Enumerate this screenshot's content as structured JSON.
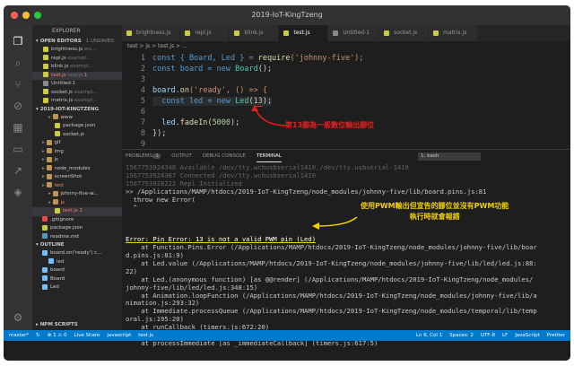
{
  "window": {
    "title": "2019-IoT-KingTzeng"
  },
  "sidebar": {
    "title": "EXPLORER",
    "open_editors_label": "OPEN EDITORS",
    "open_editors_badge": "1 UNSAVED",
    "open_editors": [
      {
        "label": "brightness.js",
        "suffix": "wo...",
        "color": "#cbcb41"
      },
      {
        "label": "repl.js",
        "suffix": "exampl...",
        "color": "#cbcb41"
      },
      {
        "label": "blink.js",
        "suffix": "exampl...",
        "color": "#cbcb41"
      },
      {
        "label": "test.js",
        "suffix": "test/js",
        "badge": "1",
        "color": "#cbcb41"
      },
      {
        "label": "Untitled-1",
        "suffix": "",
        "color": "#8a8a8a"
      },
      {
        "label": "socket.js",
        "suffix": "exampl...",
        "color": "#cbcb41"
      },
      {
        "label": "matrix.js",
        "suffix": "exampl...",
        "color": "#cbcb41"
      }
    ],
    "project_label": "2019-IOT-KINGTZENG",
    "tree": [
      {
        "label": "www",
        "indent": 2,
        "kind": "folder"
      },
      {
        "label": "package.json",
        "indent": 3,
        "kind": "json"
      },
      {
        "label": "socket.js",
        "indent": 3,
        "kind": "js"
      },
      {
        "label": "gif",
        "indent": 1,
        "kind": "folder"
      },
      {
        "label": "img",
        "indent": 1,
        "kind": "folder"
      },
      {
        "label": "js",
        "indent": 1,
        "kind": "folder"
      },
      {
        "label": "node_modules",
        "indent": 1,
        "kind": "folder"
      },
      {
        "label": "screenShot",
        "indent": 1,
        "kind": "folder"
      },
      {
        "label": "test",
        "indent": 1,
        "kind": "folder-red"
      },
      {
        "label": "johnny-five-w...",
        "indent": 2,
        "kind": "folder"
      },
      {
        "label": "js",
        "indent": 2,
        "kind": "folder-red"
      },
      {
        "label": "test.js",
        "indent": 3,
        "kind": "js-red",
        "badge": "1"
      },
      {
        "label": ".gitignore",
        "indent": 1,
        "kind": "git"
      },
      {
        "label": "package.json",
        "indent": 1,
        "kind": "json"
      },
      {
        "label": "readme.md",
        "indent": 1,
        "kind": "md"
      }
    ],
    "outline_label": "OUTLINE",
    "outline": [
      {
        "label": "board.on('ready') c...",
        "indent": 1
      },
      {
        "label": "led",
        "indent": 2
      },
      {
        "label": "board",
        "indent": 1
      },
      {
        "label": "Board",
        "indent": 1
      },
      {
        "label": "Led",
        "indent": 1
      }
    ],
    "npm_label": "NPM SCRIPTS"
  },
  "tabs": [
    {
      "label": "brightness.js",
      "active": false
    },
    {
      "label": "repl.js",
      "active": false
    },
    {
      "label": "blink.js",
      "active": false
    },
    {
      "label": "test.js",
      "active": true
    },
    {
      "label": "Untitled-1",
      "active": false
    },
    {
      "label": "socket.js",
      "active": false
    },
    {
      "label": "matrix.js",
      "active": false
    }
  ],
  "breadcrumb": "test > js > test.js > ...",
  "editor": {
    "line_numbers": [
      "1",
      "2",
      "3",
      "4",
      "5",
      "6",
      "7",
      "8",
      "9"
    ],
    "line1_a": "const { Board, Led } = ",
    "line1_b": "require",
    "line1_c": "('johnny-five');",
    "line2_a": "const board = new ",
    "line2_b": "Board",
    "line2_c": "();",
    "line4_a": "board.",
    "line4_b": "on",
    "line4_c": "('ready', () => {",
    "line5_a": "  const led = new ",
    "line5_b": "Led",
    "line5_c": "(",
    "line5_d": "13",
    "line5_e": ");",
    "line7_a": "  led.",
    "line7_b": "fadeIn",
    "line7_c": "(",
    "line7_d": "5000",
    "line7_e": ");",
    "line8": "});"
  },
  "panel": {
    "tabs": [
      "PROBLEMS",
      "OUTPUT",
      "DEBUG CONSOLE",
      "TERMINAL"
    ],
    "problems_count": "1",
    "active_tab": "TERMINAL",
    "terminal_select": "1: bash",
    "lines": [
      "1567753924348 Available /dev/tty.wchusbserial1410,/dev/tty.usbserial-1410",
      "1567753924367 Connected /dev/tty.wchusbserial1410",
      "1567753928222 Repl Initialized",
      ">> /Applications/MAMP/htdocs/2019-IoT-KingTzeng/node_modules/johnny-five/lib/board.pins.js:81",
      "  throw new Error(",
      "  ^",
      "",
      "",
      "",
      "Error: Pin Error: 13 is not a valid PWM pin (Led)",
      "    at Function.Pins.Error (/Applications/MAMP/htdocs/2019-IoT-KingTzeng/node_modules/johnny-five/lib/boar",
      "d.pins.js:81:9)",
      "    at Led.value (/Applications/MAMP/htdocs/2019-IoT-KingTzeng/node_modules/johnny-five/lib/led/led.js:88:",
      "22)",
      "    at Led.(anonymous function) [as @@render] (/Applications/MAMP/htdocs/2019-IoT-KingTzeng/node_modules/",
      "johnny-five/lib/led/led.js:348:15)",
      "    at Animation.loopFunction (/Applications/MAMP/htdocs/2019-IoT-KingTzeng/node_modules/johnny-five/lib/a",
      "nimation.js:293:32)",
      "    at Immediate.processQueue (/Applications/MAMP/htdocs/2019-IoT-KingTzeng/node_modules/temporal/lib/temp",
      "oral.js:195:20)",
      "    at runCallback (timers.js:672:20)",
      "    at tryOnImmediate (timers.js:645:5)",
      "    at processImmediate [as _immediateCallback] (timers.js:617:5)"
    ]
  },
  "annotations": {
    "red": "第13腳為一般數位輸出腳位",
    "yellow_line1": "使用PWM輸出但宣告的腳位並沒有PWM功能",
    "yellow_line2": "執行時就會報錯"
  },
  "statusbar": {
    "branch": "master*",
    "sync": "↻",
    "errors": "⊗ 1 ⚠ 0",
    "live_share": "Live Share",
    "language_hint": "javascript",
    "file": "test.js",
    "position": "Ln 6, Col 1",
    "spaces": "Spaces: 2",
    "encoding": "UTF-8",
    "eol": "LF",
    "language": "JavaScript",
    "prettier": "Prettier"
  },
  "colors": {
    "annotation_red": "#e81e1e",
    "annotation_yellow": "#f0d000",
    "status_blue": "#007acc"
  }
}
